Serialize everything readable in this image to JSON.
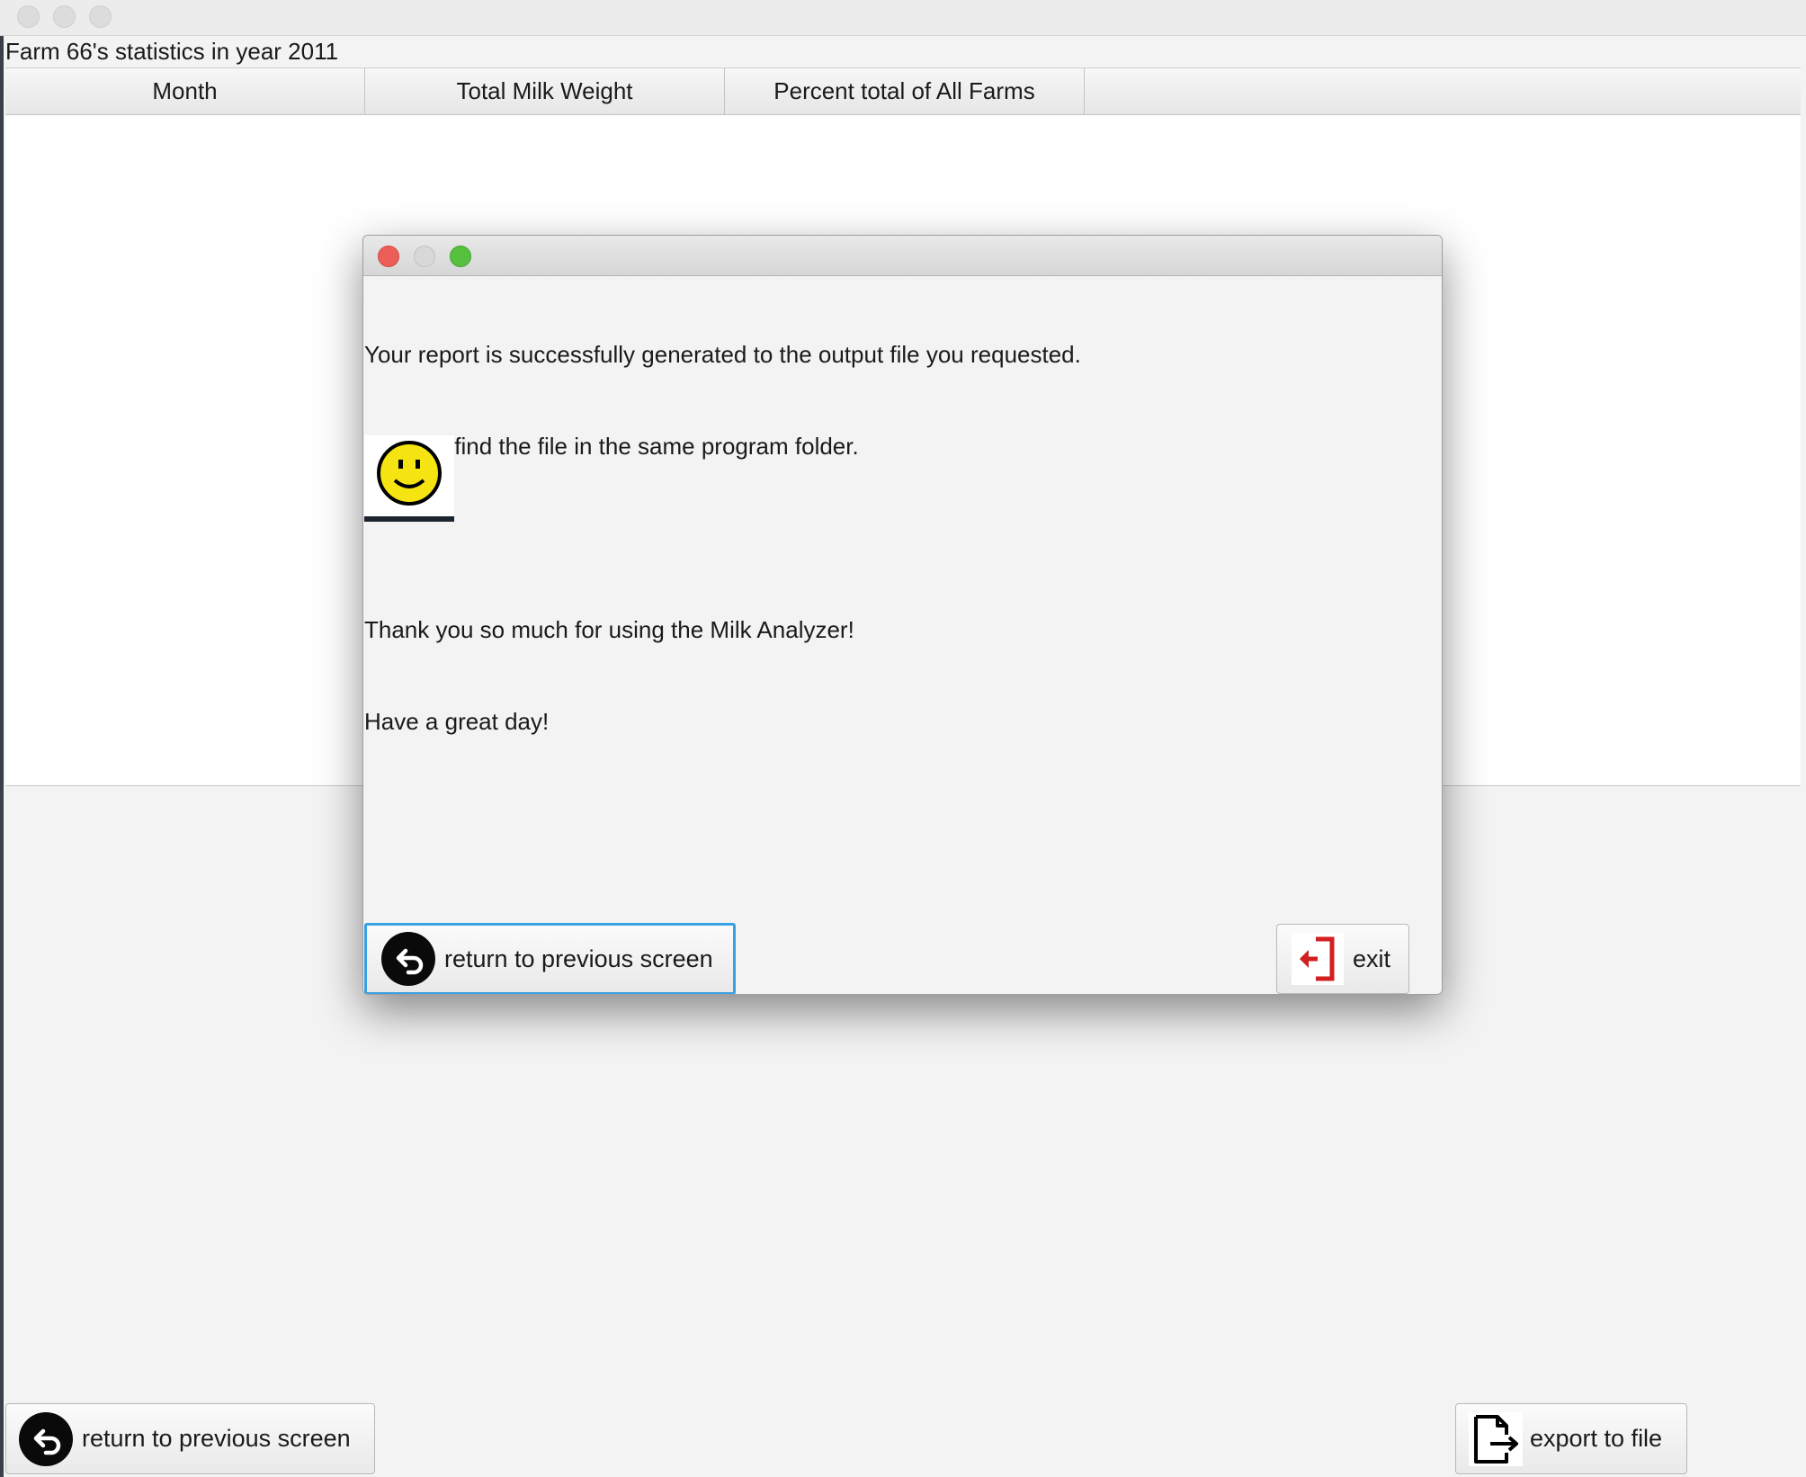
{
  "window": {
    "header_label": "Farm 66's statistics in year 2011"
  },
  "table": {
    "columns": [
      "Month",
      "Total Milk Weight",
      "Percent total of All Farms"
    ]
  },
  "bottom_bar": {
    "return_label": "return to previous screen",
    "export_label": "export to file"
  },
  "dialog": {
    "message_lines": [
      "Your report is successfully generated to the output file you requested.",
      "You can find the file in the same program folder.",
      "",
      "Thank you so much for using the Milk Analyzer!",
      "Have a great day!"
    ],
    "return_label": "return to previous screen",
    "exit_label": "exit"
  },
  "colors": {
    "dialog_close": "#ec5f58",
    "dialog_maximize": "#56c13f",
    "focus_border": "#3aa0e4",
    "smiley_face": "#f5e411",
    "exit_icon": "#d21f1f"
  },
  "icons": {
    "return": "return-arrow-icon",
    "export": "export-file-icon",
    "exit": "exit-door-icon",
    "smiley": "smiley-face-icon"
  }
}
